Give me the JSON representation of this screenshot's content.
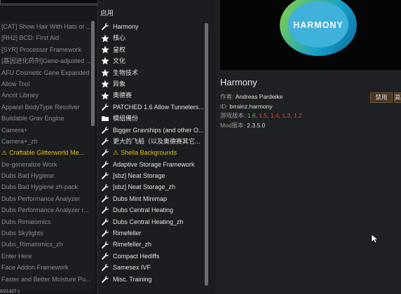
{
  "left_list": [
    {
      "label": "[CAT] Show Hair With Hats or ...",
      "warn": false
    },
    {
      "label": "[RH2] BCD: First Aid",
      "warn": false
    },
    {
      "label": "[SYR] Processor Framework",
      "warn": false
    },
    {
      "label": "[基因进化药剂]Gene-adjusted ...",
      "warn": false
    },
    {
      "label": "AFU Cosmetic Gene Expanded",
      "warn": false
    },
    {
      "label": "Allow Tool",
      "warn": false
    },
    {
      "label": "Ancot Library",
      "warn": false
    },
    {
      "label": "Apparel BodyType Resolver",
      "warn": false
    },
    {
      "label": "Buildable Grav Engine",
      "warn": false
    },
    {
      "label": "Camera+",
      "warn": false
    },
    {
      "label": "Camera+_zh",
      "warn": false
    },
    {
      "label": "Craftable Glitterworld Me...",
      "warn": true
    },
    {
      "label": "De-generalize Work",
      "warn": false
    },
    {
      "label": "Dubs Bad Hygiene",
      "warn": false
    },
    {
      "label": "Dubs Bad Hygiene zh-pack",
      "warn": false
    },
    {
      "label": "Dubs Performance Analyzer",
      "warn": false
    },
    {
      "label": "Dubs Performance Analyzer r...",
      "warn": false
    },
    {
      "label": "Dubs Rimatomics",
      "warn": false
    },
    {
      "label": "Dubs Skylights",
      "warn": false
    },
    {
      "label": "Dubs_Rimatomics_zh",
      "warn": false
    },
    {
      "label": "Enter Here",
      "warn": false
    },
    {
      "label": "Face Addon Framework",
      "warn": false
    },
    {
      "label": "Faster and Better Moisture Pu...",
      "warn": false
    }
  ],
  "mid_title": "启用",
  "mid_list": [
    {
      "label": "Harmony",
      "icon": "wrench-icon",
      "warn": false
    },
    {
      "label": "核心",
      "icon": "star-icon",
      "warn": false
    },
    {
      "label": "皇权",
      "icon": "star-icon",
      "warn": false
    },
    {
      "label": "文化",
      "icon": "star-icon",
      "warn": false
    },
    {
      "label": "生物技术",
      "icon": "star-icon",
      "warn": false
    },
    {
      "label": "异象",
      "icon": "star-icon",
      "warn": false
    },
    {
      "label": "奥德赛",
      "icon": "star-icon",
      "warn": false
    },
    {
      "label": "PATCHED 1.6 Allow Tunnelers...",
      "icon": "wrench-icon",
      "warn": false
    },
    {
      "label": "模组備份",
      "icon": "folder-icon",
      "warn": false
    },
    {
      "label": "Bigger Gravships (and other O...",
      "icon": "wrench-icon",
      "warn": false
    },
    {
      "label": "更大的飞船（以及奥德赛其它...",
      "icon": "wrench-icon",
      "warn": false
    },
    {
      "label": "Shella Backgrounds",
      "icon": "wrench-icon",
      "warn": true
    },
    {
      "label": "Adaptive Storage Framework",
      "icon": "wrench-icon",
      "warn": false
    },
    {
      "label": "[sbz] Neat Storage",
      "icon": "wrench-icon",
      "warn": false
    },
    {
      "label": "[sbz] Neat Storage_zh",
      "icon": "wrench-icon",
      "warn": false
    },
    {
      "label": "Dubs Mint Minimap",
      "icon": "wrench-icon",
      "warn": false
    },
    {
      "label": "Dubs Central Heating",
      "icon": "wrench-icon",
      "warn": false
    },
    {
      "label": "Dubs Central Heating_zh",
      "icon": "wrench-icon",
      "warn": false
    },
    {
      "label": "Rimefeller",
      "icon": "wrench-icon",
      "warn": false
    },
    {
      "label": "Rimefeller_zh",
      "icon": "wrench-icon",
      "warn": false
    },
    {
      "label": "Compact Hediffs",
      "icon": "wrench-icon",
      "warn": false
    },
    {
      "label": "Samesex IVF",
      "icon": "wrench-icon",
      "warn": false
    },
    {
      "label": "Misc. Training",
      "icon": "wrench-icon",
      "warn": false
    }
  ],
  "detail": {
    "logo_text": "HARMONY",
    "name": "Harmony",
    "author_key": "作者:",
    "author": "Andreas Pardeike",
    "id_key": "ID:",
    "id": "brrainz.harmony",
    "versions_key": "游戏版本:",
    "versions": [
      {
        "v": "1.6",
        "supported": true
      },
      {
        "v": "1.5",
        "supported": false
      },
      {
        "v": "1.4",
        "supported": false
      },
      {
        "v": "1.3",
        "supported": false
      },
      {
        "v": "1.2",
        "supported": false
      }
    ],
    "modver_key": "Mod版本:",
    "modver": "2.3.5.0",
    "disable_label": "禁用",
    "more_label": "高"
  },
  "bottom_text": "0/22,627 s"
}
